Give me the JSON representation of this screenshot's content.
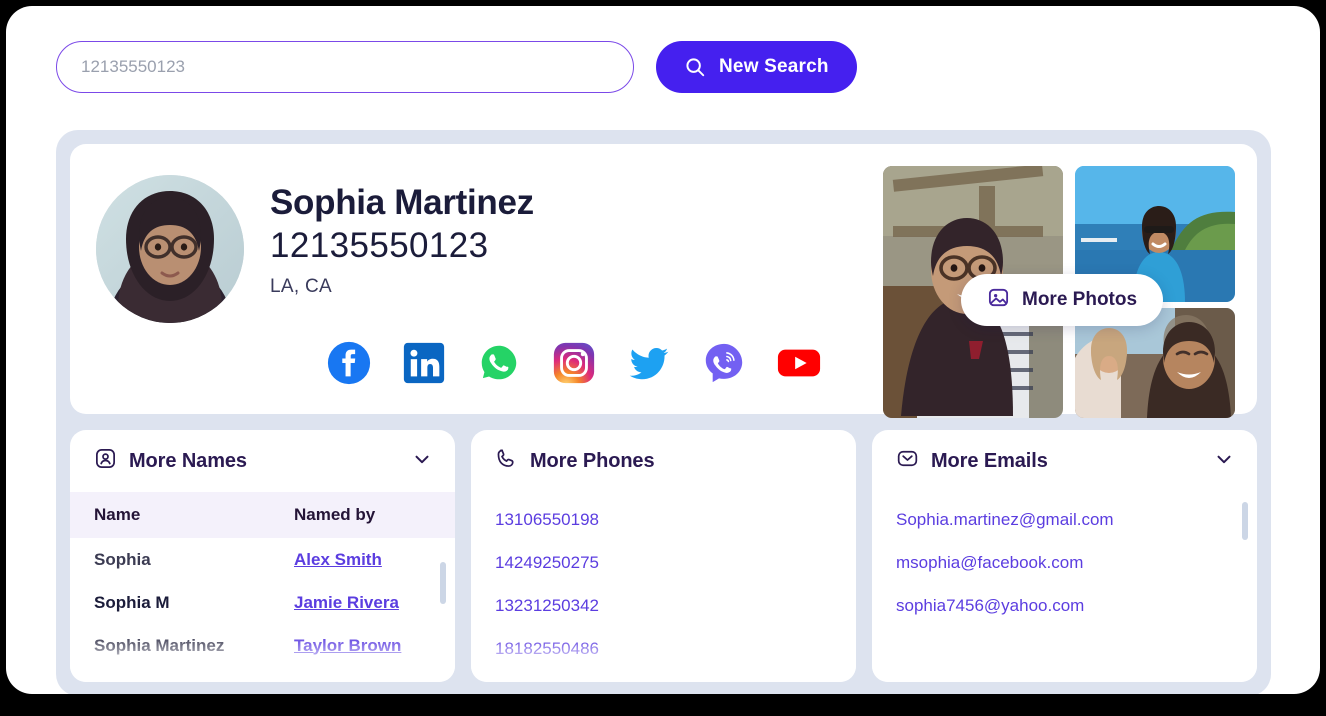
{
  "search": {
    "value": "12135550123",
    "placeholder": "12135550123",
    "button_label": "New Search",
    "button_icon": "search-icon",
    "button_color": "#4520ef",
    "border_color": "#7b49e8"
  },
  "profile": {
    "name": "Sophia Martinez",
    "phone": "12135550123",
    "location": "LA, CA",
    "avatar_alt": "woman-with-glasses-portrait",
    "socials": [
      {
        "name": "facebook",
        "color": "#1877F2"
      },
      {
        "name": "linkedin",
        "color": "#0A66C2"
      },
      {
        "name": "whatsapp",
        "color": "#25D366"
      },
      {
        "name": "instagram",
        "color": "#E1306C"
      },
      {
        "name": "twitter",
        "color": "#1DA1F2"
      },
      {
        "name": "viber",
        "color": "#7360F2"
      },
      {
        "name": "youtube",
        "color": "#FF0000"
      }
    ],
    "photos": {
      "more_photos_label": "More Photos",
      "more_photos_icon": "image-icon",
      "items": [
        {
          "alt": "woman-smiling-outdoors-striped-shirt"
        },
        {
          "alt": "woman-sunglasses-blue-top-by-the-sea"
        },
        {
          "alt": "two-women-laughing-outdoors"
        }
      ]
    }
  },
  "names_card": {
    "title": "More Names",
    "icon": "user-square-icon",
    "chevron": "chevron-down-icon",
    "columns": [
      "Name",
      "Named by"
    ],
    "rows": [
      {
        "name": "Sophia",
        "named_by": "Alex Smith"
      },
      {
        "name": "Sophia M",
        "named_by": "Jamie Rivera"
      },
      {
        "name": "Sophia Martinez",
        "named_by": "Taylor Brown"
      }
    ]
  },
  "phones_card": {
    "title": "More Phones",
    "icon": "phone-icon",
    "items": [
      "13106550198",
      "14249250275",
      "13231250342",
      "18182550486"
    ]
  },
  "emails_card": {
    "title": "More Emails",
    "icon": "envelope-icon",
    "chevron": "chevron-down-icon",
    "items": [
      "Sophia.martinez@gmail.com",
      "msophia@facebook.com",
      "sophia7456@yahoo.com"
    ]
  },
  "theme": {
    "accent": "#4520ef",
    "link": "#5b3de0",
    "dark": "#1b1c3a",
    "shell_bg": "#dde3ef",
    "thead_bg": "#f4f1fb"
  }
}
